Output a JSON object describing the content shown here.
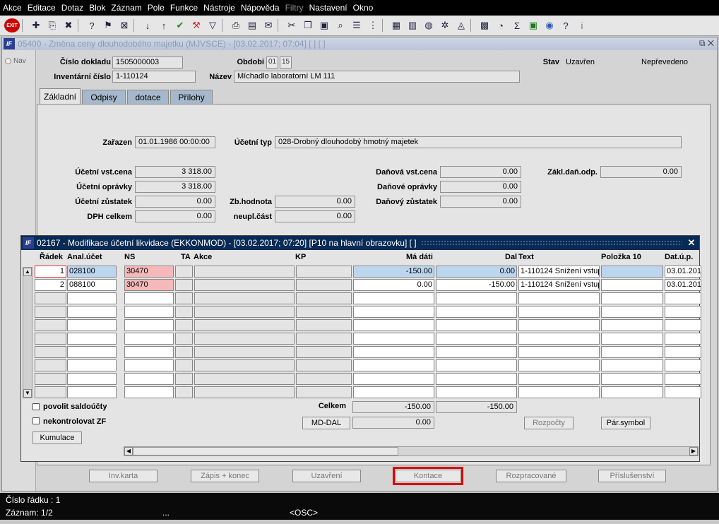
{
  "menu": [
    "Akce",
    "Editace",
    "Dotaz",
    "Blok",
    "Záznam",
    "Pole",
    "Funkce",
    "Nástroje",
    "Nápověda",
    "Filtry",
    "Nastavení",
    "Okno"
  ],
  "menu_disabled": "Filtry",
  "toolbar": {
    "exit_label": "EXIT"
  },
  "window": {
    "title": "05400 - Změna ceny dlouhodobého majetku (MJVSCE) - [03.02.2017; 07:04] [ ] [ ]",
    "nav_label": "Nav"
  },
  "header": {
    "cislo_dokladu_label": "Číslo dokladu",
    "cislo_dokladu": "1505000003",
    "obdobi_label": "Období",
    "obdobi_1": "01",
    "obdobi_2": "15",
    "stav_label": "Stav",
    "stav": "Uzavřen",
    "stav2": "Nepřevedeno",
    "inv_cislo_label": "Inventární číslo",
    "inv_cislo": "1-110124",
    "nazev_label": "Název",
    "nazev": "Míchadlo laboratorní LM 111"
  },
  "tabs": [
    "Základní",
    "Odpisy",
    "dotace",
    "Přílohy"
  ],
  "basic": {
    "zarazen_label": "Zařazen",
    "zarazen": "01.01.1986 00:00:00",
    "ucetni_typ_label": "Účetní typ",
    "ucetni_typ": "028-Drobný dlouhodobý hmotný majetek",
    "uc_vst_cena_label": "Účetní vst.cena",
    "uc_vst_cena": "3 318.00",
    "uc_opravky_label": "Účetní oprávky",
    "uc_opravky": "3 318.00",
    "uc_zustatek_label": "Účetní zůstatek",
    "uc_zustatek": "0.00",
    "dph_label": "DPH celkem",
    "dph": "0.00",
    "zb_hodnota_label": "Zb.hodnota",
    "zb_hodnota": "0.00",
    "neupl_label": "neupl.část",
    "neupl": "0.00",
    "dan_vst_cena_label": "Daňová vst.cena",
    "dan_vst_cena": "0.00",
    "dan_opravky_label": "Daňové oprávky",
    "dan_opravky": "0.00",
    "dan_zustatek_label": "Daňový zůstatek",
    "dan_zustatek": "0.00",
    "zakl_dan_label": "Zákl.daň.odp.",
    "zakl_dan": "0.00"
  },
  "modal": {
    "title": "02167 - Modifikace účetní likvidace (EKKONMOD) - [03.02.2017; 07:20] [P10 na hlavní obrazovku] [ ]",
    "columns": {
      "radek": "Řádek",
      "anal": "Anal.účet",
      "ns": "NS",
      "ta": "TA",
      "akce": "Akce",
      "kp": "KP",
      "ma_dati": "Má dáti",
      "dal": "Dal",
      "text": "Text",
      "polozka": "Položka 10",
      "dat": "Dat.ú.p."
    },
    "rows": [
      {
        "radek": "1",
        "anal": "028100",
        "ns": "30470",
        "ma_dati": "-150.00",
        "dal": "0.00",
        "text": "1-110124 Snížení vstup",
        "dat": "03.01.201"
      },
      {
        "radek": "2",
        "anal": "088100",
        "ns": "30470",
        "ma_dati": "0.00",
        "dal": "-150.00",
        "text": "1-110124 Snížení vstup",
        "dat": "03.01.201"
      }
    ],
    "povolit_label": "povolit saldoúčty",
    "nekontrolovat_label": "nekontrolovat ZF",
    "kumulace_label": "Kumulace",
    "celkem_label": "Celkem",
    "celkem_ma": "-150.00",
    "celkem_dal": "-150.00",
    "mddal_label": "MD-DAL",
    "mddal": "0.00",
    "rozpocty_label": "Rozpočty",
    "par_symbol_label": "Pár.symbol"
  },
  "buttons": [
    "Inv.karta",
    "Zápis + konec",
    "Uzavření",
    "Kontace",
    "Rozpracované",
    "Příslušenství"
  ],
  "status": {
    "line1": "Číslo řádku : 1",
    "zaznam": "Záznam: 1/2",
    "dots": "...",
    "osc": "<OSC>"
  },
  "colors": {
    "highlight_box": "#e00000",
    "title_bar": "#082b56",
    "tab_inactive": "#a6b8cc"
  }
}
